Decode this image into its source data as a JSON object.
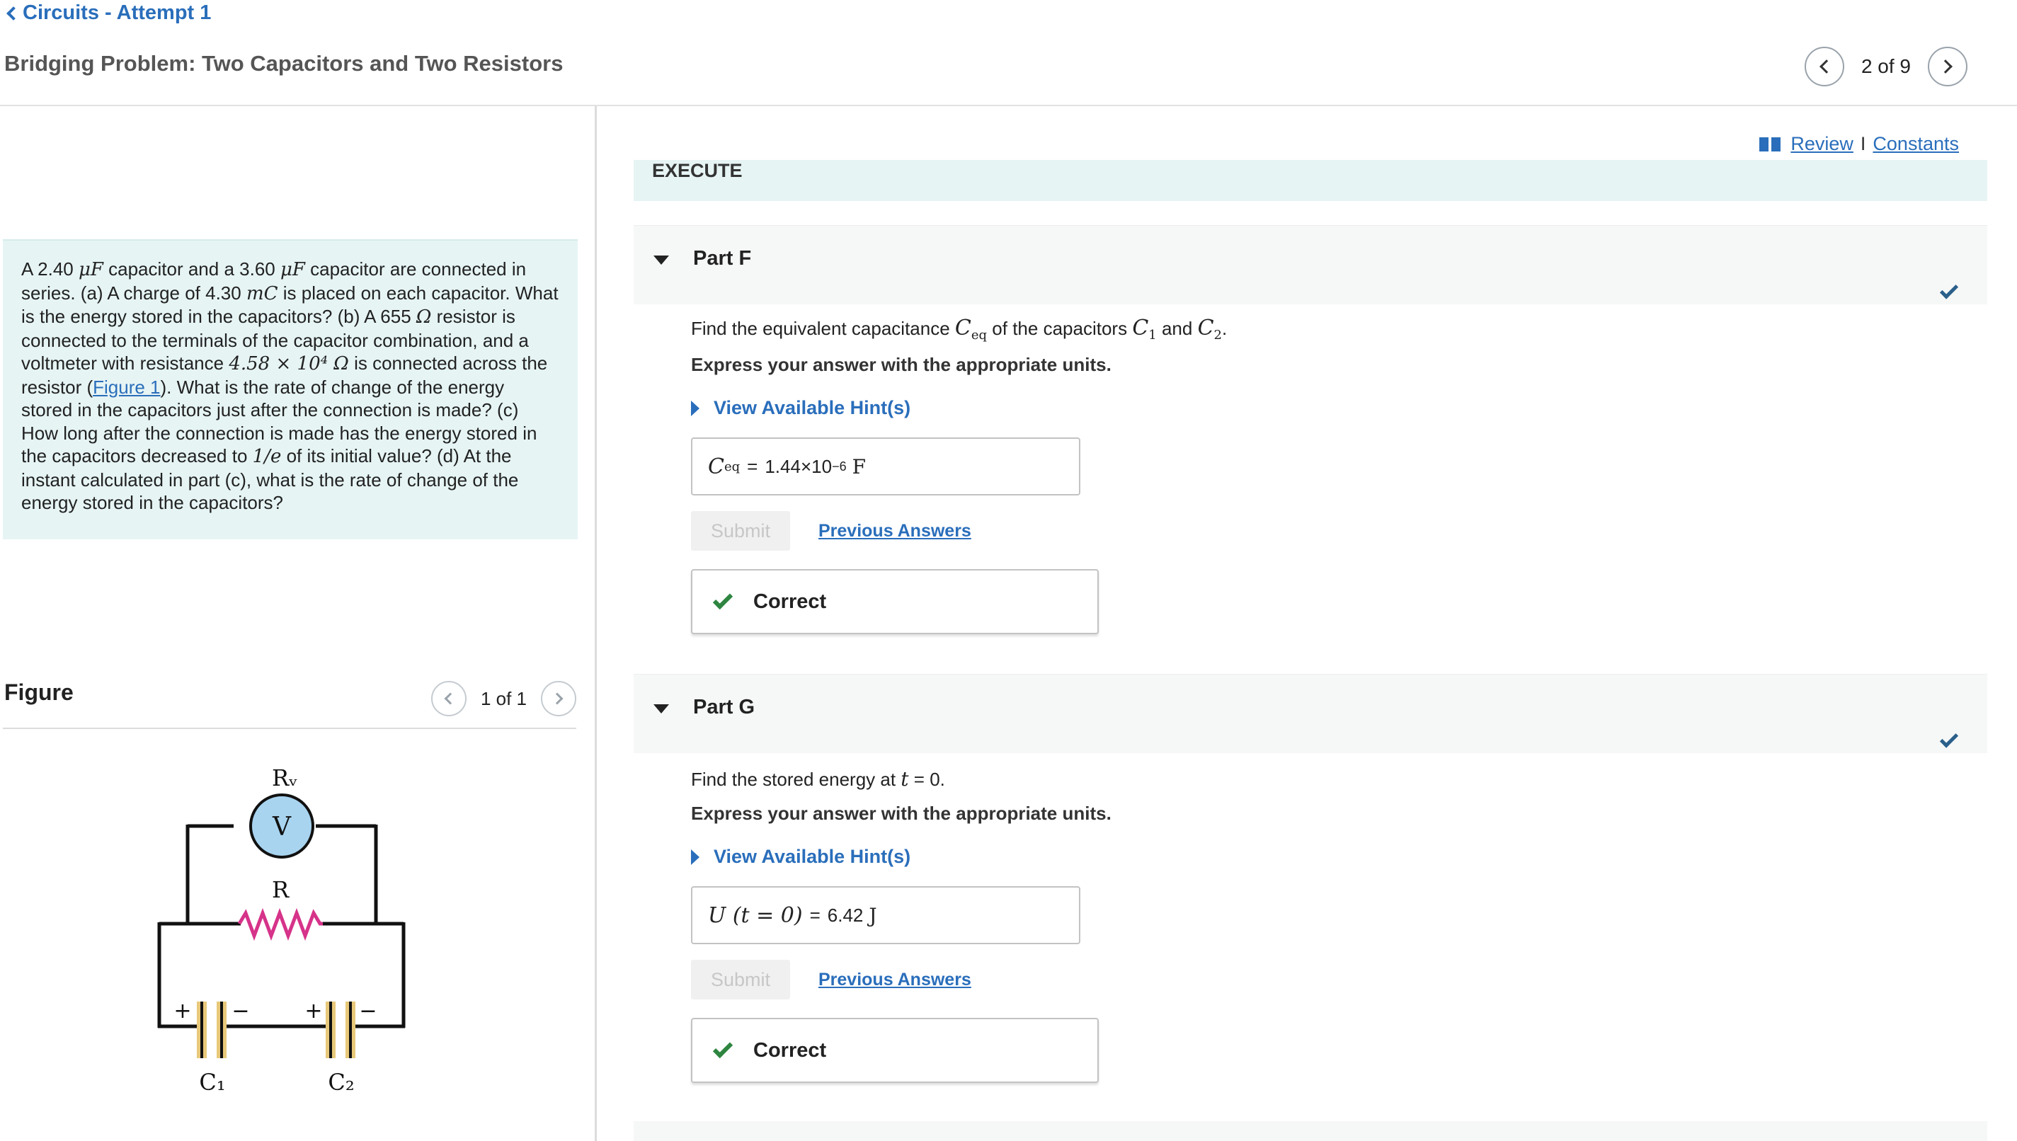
{
  "header": {
    "back_label": "Circuits - Attempt 1",
    "title": "Bridging Problem: Two Capacitors and Two Resistors",
    "pager_text": "2 of 9"
  },
  "problem": {
    "t1": "A 2.40 ",
    "m1": "μF",
    "t2": " capacitor and a 3.60 ",
    "m2": "μF",
    "t3": " capacitor are connected in series. (a) A charge of 4.30 ",
    "m3": "mC",
    "t4": " is placed on each capacitor. What is the energy stored in the capacitors? (b) A 655 ",
    "m4": "Ω",
    "t5": " resistor is connected to the terminals of the capacitor combination, and a voltmeter with resistance ",
    "m5": "4.58 × 10⁴ Ω",
    "t6": " is connected across the resistor (",
    "figure_link": "Figure 1",
    "t7": "). What is the rate of change of the energy stored in the capacitors just after the connection is made? (c) How long after the connection is made has the energy stored in the capacitors decreased to ",
    "m6": "1/e",
    "t8": " of its initial value? (d) At the instant calculated in part (c), what is the rate of change of the energy stored in the capacitors?"
  },
  "figure": {
    "title": "Figure",
    "pager_text": "1 of 1",
    "labels": {
      "rv": "Rᵥ",
      "v": "V",
      "r": "R",
      "c1": "C₁",
      "c2": "C₂",
      "plus": "+",
      "minus": "−"
    },
    "colors": {
      "voltmeter_fill": "#a8d4f0",
      "resistor": "#d6338a",
      "capacitor_plate": "#e8c97a"
    }
  },
  "links": {
    "review": "Review",
    "separator": "I",
    "constants": "Constants"
  },
  "execute_label": "EXECUTE",
  "parts": [
    {
      "label": "Part F",
      "question_pre": "Find the equivalent capacitance ",
      "q_sym1": "C",
      "q_sub1": "eq",
      "question_mid": " of the capacitors ",
      "q_sym2": "C",
      "q_sub2": "1",
      "question_and": " and ",
      "q_sym3": "C",
      "q_sub3": "2",
      "question_end": ".",
      "express": "Express your answer with the appropriate units.",
      "hints": "View Available Hint(s)",
      "answer_symbol": "C",
      "answer_sub": "eq",
      "answer_eq": "=",
      "answer_value": "1.44×10",
      "answer_exp": "−6",
      "answer_unit": "F",
      "submit": "Submit",
      "previous": "Previous Answers",
      "feedback": "Correct"
    },
    {
      "label": "Part G",
      "question_pre": "Find the stored energy at ",
      "q_sym1": "t",
      "question_end": " = 0.",
      "express": "Express your answer with the appropriate units.",
      "hints": "View Available Hint(s)",
      "answer_symbol": "U (t = 0)",
      "answer_eq": "=",
      "answer_value": "6.42",
      "answer_unit": "J",
      "submit": "Submit",
      "previous": "Previous Answers",
      "feedback": "Correct"
    }
  ]
}
